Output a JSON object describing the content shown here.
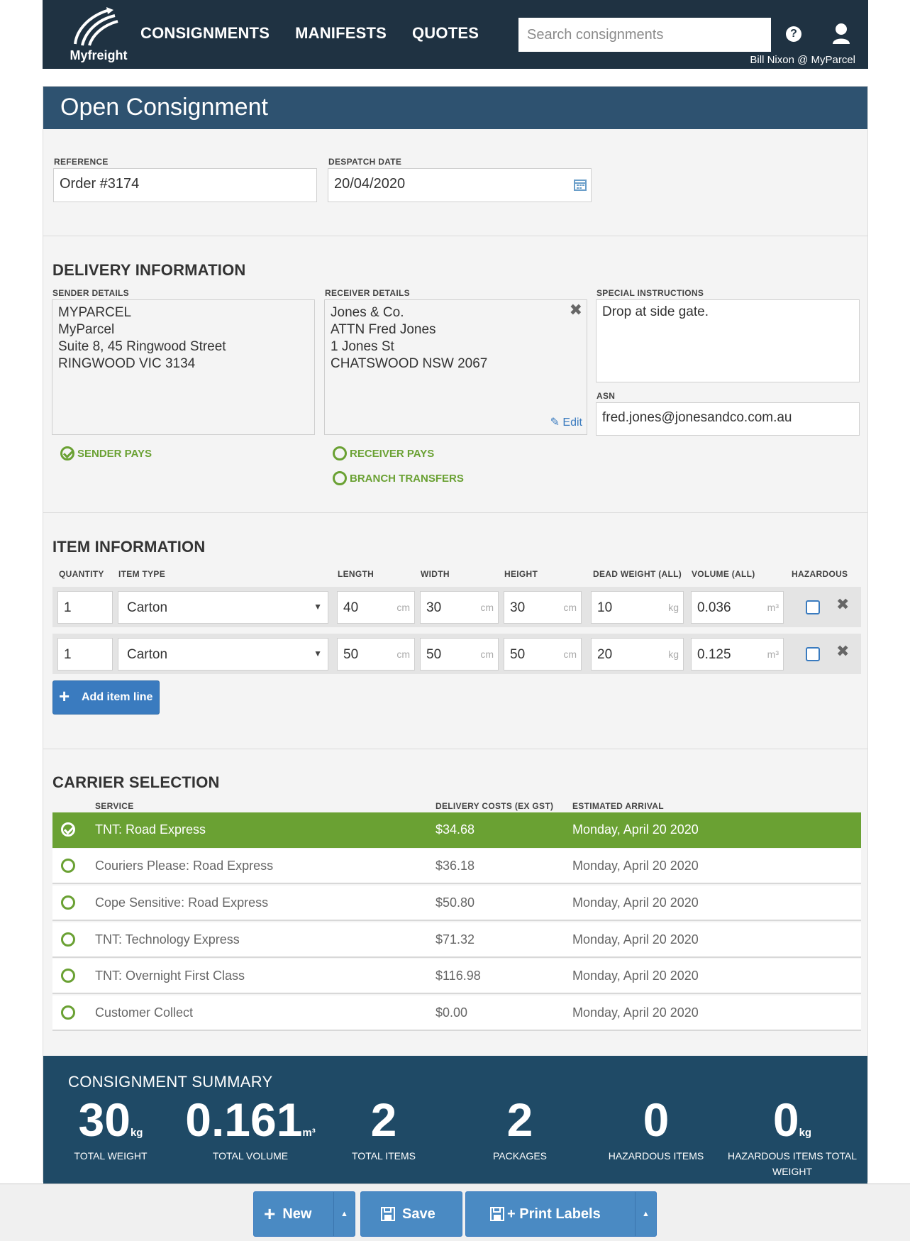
{
  "header": {
    "logo_text": "Myfreight",
    "nav": [
      "CONSIGNMENTS",
      "MANIFESTS",
      "QUOTES"
    ],
    "search_placeholder": "Search consignments",
    "help_icon_glyph": "?",
    "user_label": "Bill Nixon @ MyParcel"
  },
  "page_title": "Open Consignment",
  "consignment": {
    "reference_label": "REFERENCE",
    "reference_value": "Order #3174",
    "despatch_label": "DESPATCH DATE",
    "despatch_value": "20/04/2020"
  },
  "delivery": {
    "title": "DELIVERY INFORMATION",
    "sender_label": "SENDER DETAILS",
    "sender_lines": [
      "MYPARCEL",
      "MyParcel",
      "Suite 8, 45 Ringwood Street",
      "RINGWOOD VIC 3134"
    ],
    "receiver_label": "RECEIVER DETAILS",
    "receiver_lines": [
      "Jones & Co.",
      "ATTN Fred Jones",
      "1 Jones St",
      "CHATSWOOD NSW 2067"
    ],
    "edit_label": "Edit",
    "special_label": "SPECIAL INSTRUCTIONS",
    "special_value": "Drop at side gate.",
    "asn_label": "ASN",
    "asn_value": "fred.jones@jonesandco.com.au",
    "sender_pays": "SENDER PAYS",
    "receiver_pays": "RECEIVER PAYS",
    "branch_transfers": "BRANCH TRANSFERS"
  },
  "items": {
    "title": "ITEM INFORMATION",
    "headers": [
      "QUANTITY",
      "ITEM TYPE",
      "LENGTH",
      "WIDTH",
      "HEIGHT",
      "DEAD WEIGHT (ALL)",
      "VOLUME (ALL)",
      "HAZARDOUS"
    ],
    "units": {
      "cm": "cm",
      "kg": "kg",
      "m3": "m³"
    },
    "rows": [
      {
        "qty": "1",
        "type": "Carton",
        "length": "40",
        "width": "30",
        "height": "30",
        "weight": "10",
        "volume": "0.036"
      },
      {
        "qty": "1",
        "type": "Carton",
        "length": "50",
        "width": "50",
        "height": "50",
        "weight": "20",
        "volume": "0.125"
      }
    ],
    "add_label": "Add item line"
  },
  "carrier": {
    "title": "CARRIER SELECTION",
    "headers": [
      "SERVICE",
      "DELIVERY COSTS (EX GST)",
      "ESTIMATED ARRIVAL"
    ],
    "rows": [
      {
        "service": "TNT: Road Express",
        "cost": "$34.68",
        "eta": "Monday, April 20 2020",
        "selected": true
      },
      {
        "service": "Couriers Please: Road Express",
        "cost": "$36.18",
        "eta": "Monday, April 20 2020"
      },
      {
        "service": "Cope Sensitive: Road Express",
        "cost": "$50.80",
        "eta": "Monday, April 20 2020"
      },
      {
        "service": "TNT: Technology Express",
        "cost": "$71.32",
        "eta": "Monday, April 20 2020"
      },
      {
        "service": "TNT: Overnight First Class",
        "cost": "$116.98",
        "eta": "Monday, April 20 2020"
      },
      {
        "service": "Customer Collect",
        "cost": "$0.00",
        "eta": "Monday, April 20 2020"
      }
    ]
  },
  "summary": {
    "title": "CONSIGNMENT SUMMARY",
    "stats": [
      {
        "value": "30",
        "unit": "kg",
        "label": "TOTAL WEIGHT"
      },
      {
        "value": "0.161",
        "unit": "m³",
        "label": "TOTAL VOLUME"
      },
      {
        "value": "2",
        "unit": "",
        "label": "TOTAL ITEMS"
      },
      {
        "value": "2",
        "unit": "",
        "label": "PACKAGES"
      },
      {
        "value": "0",
        "unit": "",
        "label": "HAZARDOUS ITEMS"
      },
      {
        "value": "0",
        "unit": "kg",
        "label": "HAZARDOUS ITEMS TOTAL WEIGHT"
      }
    ]
  },
  "footer": {
    "new_label": "New",
    "save_label": "Save",
    "print_label": "+ Print Labels"
  },
  "colors": {
    "header_bg": "#1f3242",
    "title_bg": "#2e5270",
    "accent_green": "#6aa133",
    "accent_blue": "#3a7bbf",
    "summary_bg": "#1f4a66"
  }
}
